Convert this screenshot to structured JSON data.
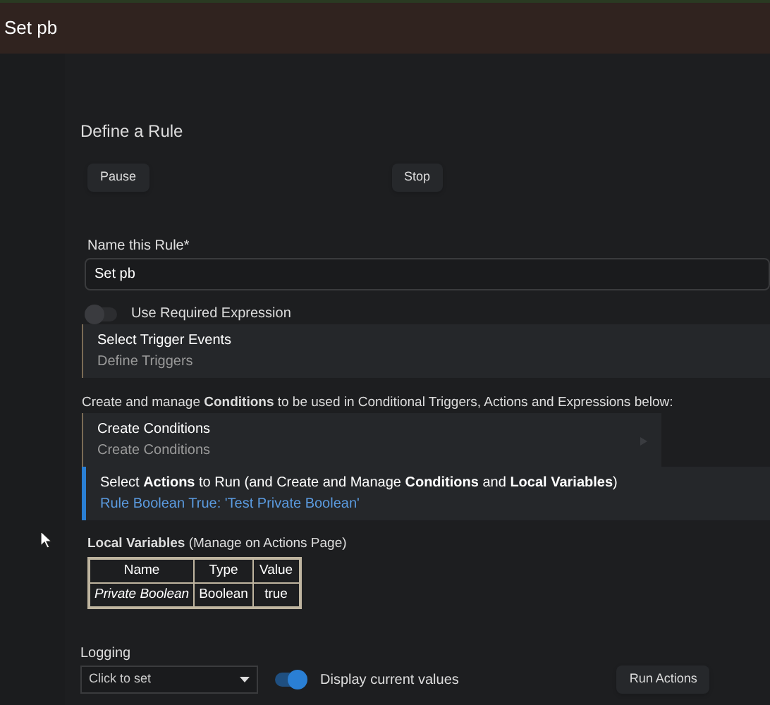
{
  "header": {
    "title": "Set pb"
  },
  "section_title": "Define a Rule",
  "buttons": [
    "Pause",
    "Stop"
  ],
  "name_field": {
    "label": "Name this Rule*",
    "value": "Set pb"
  },
  "required_expression": {
    "label": "Use Required Expression",
    "on": false
  },
  "cards": [
    {
      "title": "Select Trigger Events",
      "subtitle": "Define Triggers",
      "highlighted": false,
      "arrow": false,
      "wide": true
    },
    {
      "intro": "Create and manage **Conditions** to be used in Conditional Triggers, Actions and Expressions below:"
    },
    {
      "title": "Create Conditions",
      "subtitle": "Create Conditions",
      "highlighted": false,
      "arrow": true,
      "wide": false
    },
    {
      "title": "Select **Actions** to Run (and Create and Manage **Conditions** and **Local Variables**)",
      "subtitle": "Rule Boolean True: 'Test Private Boolean'",
      "highlighted": true,
      "arrow": false,
      "wide": true
    }
  ],
  "local_variables": {
    "title": "**Local Variables** (Manage on Actions Page)",
    "columns": [
      "Name",
      "Type",
      "Value"
    ],
    "rows": [
      [
        "Private Boolean",
        "Boolean",
        "true"
      ]
    ]
  },
  "logging": {
    "label": "Logging",
    "placeholder": "Click to set"
  },
  "display_values": {
    "label": "Display current values",
    "on": true
  },
  "run_button": "Run Actions"
}
